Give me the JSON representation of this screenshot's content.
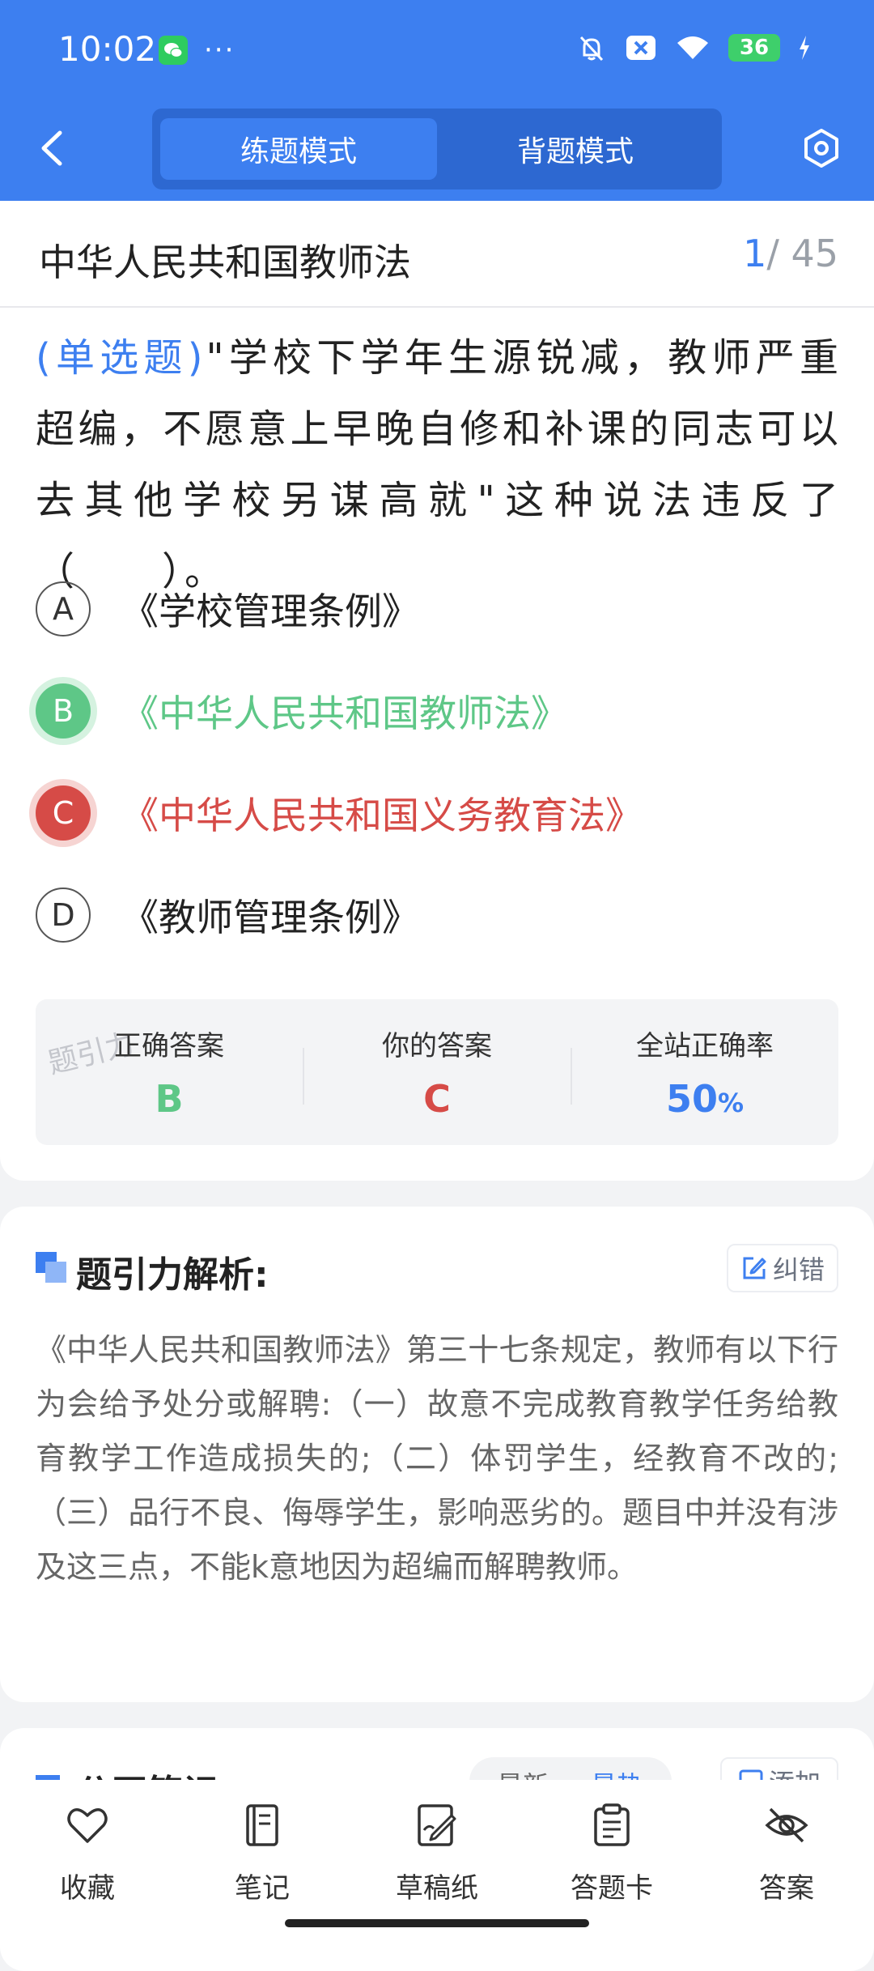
{
  "status_bar": {
    "time": "10:02",
    "battery": "36"
  },
  "nav": {
    "modes": [
      "练题模式",
      "背题模式"
    ]
  },
  "question": {
    "title": "中华人民共和国教师法",
    "current": "1",
    "total": "/ 45",
    "type": "(单选题)",
    "text": "\"学校下学年生源锐减，教师严重超编，不愿意上早晚自修和补课的同志可以去其他学校另谋高就\"这种说法违反了（　　）。",
    "options": [
      {
        "letter": "A",
        "text": "《学校管理条例》",
        "state": "normal"
      },
      {
        "letter": "B",
        "text": "《中华人民共和国教师法》",
        "state": "correct"
      },
      {
        "letter": "C",
        "text": "《中华人民共和国义务教育法》",
        "state": "wrong"
      },
      {
        "letter": "D",
        "text": "《教师管理条例》",
        "state": "normal"
      }
    ]
  },
  "answer_summary": {
    "correct_label": "正确答案",
    "correct_value": "B",
    "yours_label": "你的答案",
    "yours_value": "C",
    "rate_label": "全站正确率",
    "rate_value": "50",
    "rate_unit": "%",
    "watermark": "题引力"
  },
  "analysis": {
    "title": "题引力解析:",
    "correct_button": "纠错",
    "text": "《中华人民共和国教师法》第三十七条规定，教师有以下行为会给予处分或解聘:（一）故意不完成教育教学任务给教育教学工作造成损失的;（二）体罚学生，经教育不改的;（三）品行不良、侮辱学生，影响恶劣的。题目中并没有涉及这三点，不能k意地因为超编而解聘教师。"
  },
  "notes": {
    "title": "公开笔记:",
    "sort_options": [
      "最新",
      "最热"
    ],
    "add_button": "添加"
  },
  "bottom_tabs": [
    {
      "label": "收藏",
      "icon": "heart-icon"
    },
    {
      "label": "笔记",
      "icon": "notebook-icon"
    },
    {
      "label": "草稿纸",
      "icon": "draft-icon"
    },
    {
      "label": "答题卡",
      "icon": "clipboard-icon"
    },
    {
      "label": "答案",
      "icon": "eye-off-icon"
    }
  ],
  "colors": {
    "primary": "#3d7ff0",
    "correct": "#5ec787",
    "wrong": "#d64b47"
  }
}
